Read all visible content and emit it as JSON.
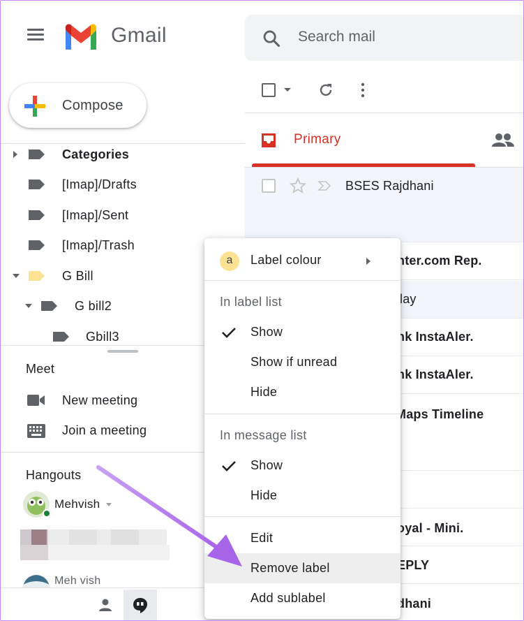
{
  "header": {
    "app_name": "Gmail",
    "search_placeholder": "Search mail"
  },
  "nav": {
    "compose_label": "Compose",
    "labels": [
      {
        "label": "Categories",
        "bold": true
      },
      {
        "label": "[Imap]/Drafts"
      },
      {
        "label": "[Imap]/Sent"
      },
      {
        "label": "[Imap]/Trash"
      },
      {
        "label": "G Bill",
        "color": "#fde293"
      },
      {
        "label": "G bill2"
      },
      {
        "label": "Gbill3"
      }
    ]
  },
  "meet": {
    "title": "Meet",
    "new_meeting": "New meeting",
    "join_meeting": "Join a meeting"
  },
  "hangouts": {
    "title": "Hangouts",
    "user": "Mehvish",
    "contact": "Meh vish",
    "status_color": "#188038"
  },
  "tabs": {
    "primary": "Primary",
    "accent_color": "#d93025"
  },
  "messages": [
    {
      "text": "BSES Rajdhani"
    },
    {
      "text": "nter.com Rep."
    },
    {
      "text": "lay"
    },
    {
      "text": "nk InstaAler."
    },
    {
      "text": "nk InstaAler."
    },
    {
      "text": "Maps Timeline"
    },
    {
      "text": "oyal - Mini."
    },
    {
      "text": "EPLY"
    },
    {
      "text": "dhani"
    }
  ],
  "context_menu": {
    "label_colour": "Label colour",
    "label_colour_chip": "a",
    "in_label_list_heading": "In label list",
    "label_list_show": "Show",
    "label_list_show_if_unread": "Show if unread",
    "label_list_hide": "Hide",
    "in_message_list_heading": "In message list",
    "message_list_show": "Show",
    "message_list_hide": "Hide",
    "edit": "Edit",
    "remove_label": "Remove label",
    "add_sublabel": "Add sublabel"
  },
  "annotation_color": "#b57bee"
}
